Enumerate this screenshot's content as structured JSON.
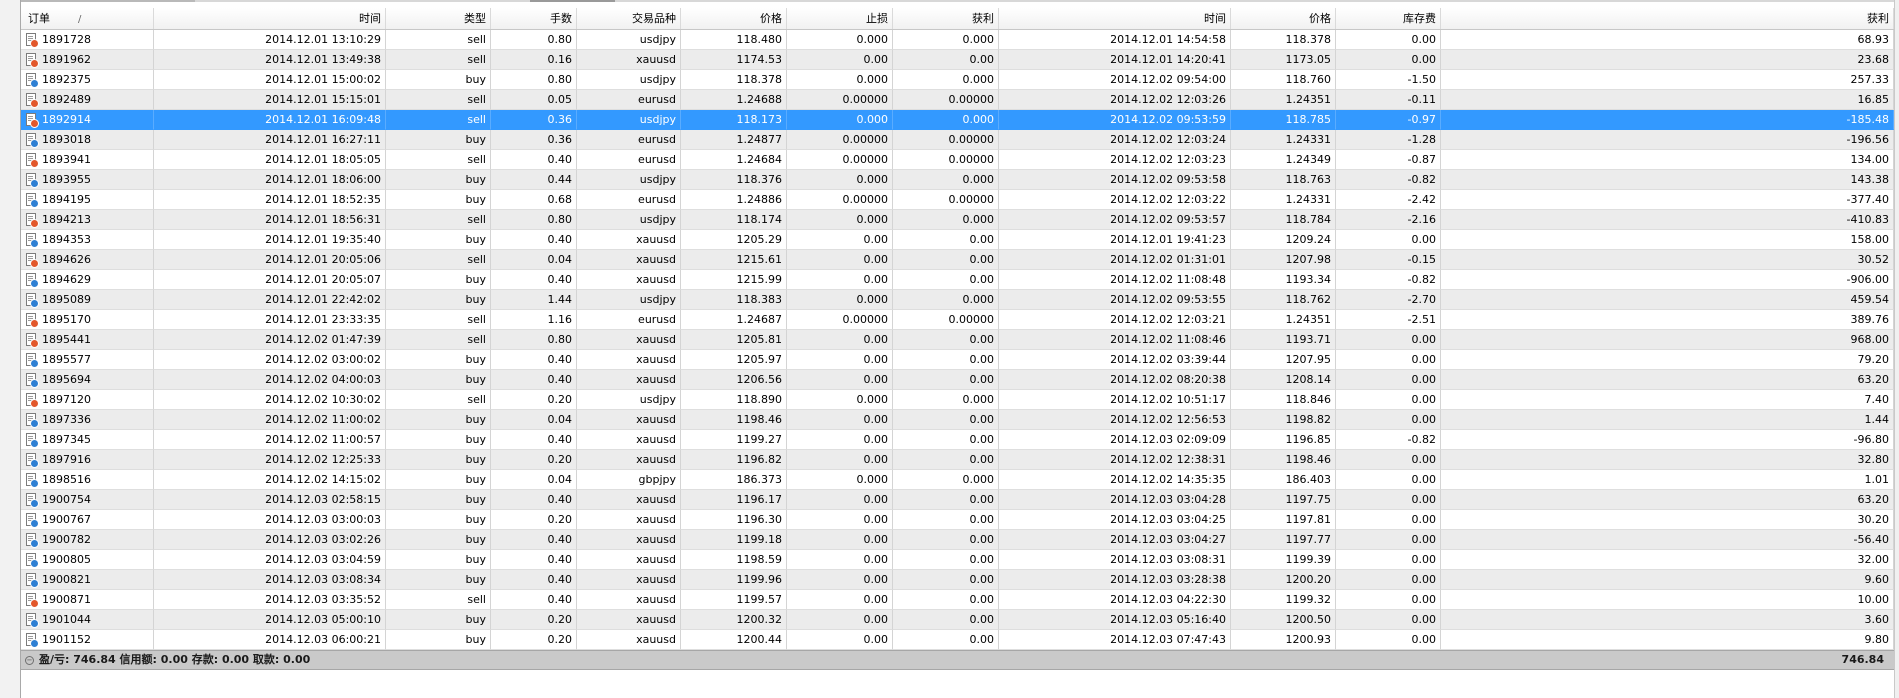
{
  "colors": {
    "selection": "#3399ff",
    "sell_badge": "#e2572b",
    "buy_badge": "#2e7fd3",
    "summary_bg": "#c9c9c9"
  },
  "sort_indicator": "/",
  "columns": [
    "订单",
    "时间",
    "类型",
    "手数",
    "交易品种",
    "价格",
    "止损",
    "获利",
    "时间",
    "价格",
    "库存费",
    "获利"
  ],
  "selected_order": "1892914",
  "rows": [
    [
      "1891728",
      "2014.12.01 13:10:29",
      "sell",
      "0.80",
      "usdjpy",
      "118.480",
      "0.000",
      "0.000",
      "2014.12.01 14:54:58",
      "118.378",
      "0.00",
      "68.93"
    ],
    [
      "1891962",
      "2014.12.01 13:49:38",
      "sell",
      "0.16",
      "xauusd",
      "1174.53",
      "0.00",
      "0.00",
      "2014.12.01 14:20:41",
      "1173.05",
      "0.00",
      "23.68"
    ],
    [
      "1892375",
      "2014.12.01 15:00:02",
      "buy",
      "0.80",
      "usdjpy",
      "118.378",
      "0.000",
      "0.000",
      "2014.12.02 09:54:00",
      "118.760",
      "-1.50",
      "257.33"
    ],
    [
      "1892489",
      "2014.12.01 15:15:01",
      "sell",
      "0.05",
      "eurusd",
      "1.24688",
      "0.00000",
      "0.00000",
      "2014.12.02 12:03:26",
      "1.24351",
      "-0.11",
      "16.85"
    ],
    [
      "1892914",
      "2014.12.01 16:09:48",
      "sell",
      "0.36",
      "usdjpy",
      "118.173",
      "0.000",
      "0.000",
      "2014.12.02 09:53:59",
      "118.785",
      "-0.97",
      "-185.48"
    ],
    [
      "1893018",
      "2014.12.01 16:27:11",
      "buy",
      "0.36",
      "eurusd",
      "1.24877",
      "0.00000",
      "0.00000",
      "2014.12.02 12:03:24",
      "1.24331",
      "-1.28",
      "-196.56"
    ],
    [
      "1893941",
      "2014.12.01 18:05:05",
      "sell",
      "0.40",
      "eurusd",
      "1.24684",
      "0.00000",
      "0.00000",
      "2014.12.02 12:03:23",
      "1.24349",
      "-0.87",
      "134.00"
    ],
    [
      "1893955",
      "2014.12.01 18:06:00",
      "buy",
      "0.44",
      "usdjpy",
      "118.376",
      "0.000",
      "0.000",
      "2014.12.02 09:53:58",
      "118.763",
      "-0.82",
      "143.38"
    ],
    [
      "1894195",
      "2014.12.01 18:52:35",
      "buy",
      "0.68",
      "eurusd",
      "1.24886",
      "0.00000",
      "0.00000",
      "2014.12.02 12:03:22",
      "1.24331",
      "-2.42",
      "-377.40"
    ],
    [
      "1894213",
      "2014.12.01 18:56:31",
      "sell",
      "0.80",
      "usdjpy",
      "118.174",
      "0.000",
      "0.000",
      "2014.12.02 09:53:57",
      "118.784",
      "-2.16",
      "-410.83"
    ],
    [
      "1894353",
      "2014.12.01 19:35:40",
      "buy",
      "0.40",
      "xauusd",
      "1205.29",
      "0.00",
      "0.00",
      "2014.12.01 19:41:23",
      "1209.24",
      "0.00",
      "158.00"
    ],
    [
      "1894626",
      "2014.12.01 20:05:06",
      "sell",
      "0.04",
      "xauusd",
      "1215.61",
      "0.00",
      "0.00",
      "2014.12.02 01:31:01",
      "1207.98",
      "-0.15",
      "30.52"
    ],
    [
      "1894629",
      "2014.12.01 20:05:07",
      "buy",
      "0.40",
      "xauusd",
      "1215.99",
      "0.00",
      "0.00",
      "2014.12.02 11:08:48",
      "1193.34",
      "-0.82",
      "-906.00"
    ],
    [
      "1895089",
      "2014.12.01 22:42:02",
      "buy",
      "1.44",
      "usdjpy",
      "118.383",
      "0.000",
      "0.000",
      "2014.12.02 09:53:55",
      "118.762",
      "-2.70",
      "459.54"
    ],
    [
      "1895170",
      "2014.12.01 23:33:35",
      "sell",
      "1.16",
      "eurusd",
      "1.24687",
      "0.00000",
      "0.00000",
      "2014.12.02 12:03:21",
      "1.24351",
      "-2.51",
      "389.76"
    ],
    [
      "1895441",
      "2014.12.02 01:47:39",
      "sell",
      "0.80",
      "xauusd",
      "1205.81",
      "0.00",
      "0.00",
      "2014.12.02 11:08:46",
      "1193.71",
      "0.00",
      "968.00"
    ],
    [
      "1895577",
      "2014.12.02 03:00:02",
      "buy",
      "0.40",
      "xauusd",
      "1205.97",
      "0.00",
      "0.00",
      "2014.12.02 03:39:44",
      "1207.95",
      "0.00",
      "79.20"
    ],
    [
      "1895694",
      "2014.12.02 04:00:03",
      "buy",
      "0.40",
      "xauusd",
      "1206.56",
      "0.00",
      "0.00",
      "2014.12.02 08:20:38",
      "1208.14",
      "0.00",
      "63.20"
    ],
    [
      "1897120",
      "2014.12.02 10:30:02",
      "sell",
      "0.20",
      "usdjpy",
      "118.890",
      "0.000",
      "0.000",
      "2014.12.02 10:51:17",
      "118.846",
      "0.00",
      "7.40"
    ],
    [
      "1897336",
      "2014.12.02 11:00:02",
      "buy",
      "0.04",
      "xauusd",
      "1198.46",
      "0.00",
      "0.00",
      "2014.12.02 12:56:53",
      "1198.82",
      "0.00",
      "1.44"
    ],
    [
      "1897345",
      "2014.12.02 11:00:57",
      "buy",
      "0.40",
      "xauusd",
      "1199.27",
      "0.00",
      "0.00",
      "2014.12.03 02:09:09",
      "1196.85",
      "-0.82",
      "-96.80"
    ],
    [
      "1897916",
      "2014.12.02 12:25:33",
      "buy",
      "0.20",
      "xauusd",
      "1196.82",
      "0.00",
      "0.00",
      "2014.12.02 12:38:31",
      "1198.46",
      "0.00",
      "32.80"
    ],
    [
      "1898516",
      "2014.12.02 14:15:02",
      "buy",
      "0.04",
      "gbpjpy",
      "186.373",
      "0.000",
      "0.000",
      "2014.12.02 14:35:35",
      "186.403",
      "0.00",
      "1.01"
    ],
    [
      "1900754",
      "2014.12.03 02:58:15",
      "buy",
      "0.40",
      "xauusd",
      "1196.17",
      "0.00",
      "0.00",
      "2014.12.03 03:04:28",
      "1197.75",
      "0.00",
      "63.20"
    ],
    [
      "1900767",
      "2014.12.03 03:00:03",
      "buy",
      "0.20",
      "xauusd",
      "1196.30",
      "0.00",
      "0.00",
      "2014.12.03 03:04:25",
      "1197.81",
      "0.00",
      "30.20"
    ],
    [
      "1900782",
      "2014.12.03 03:02:26",
      "buy",
      "0.40",
      "xauusd",
      "1199.18",
      "0.00",
      "0.00",
      "2014.12.03 03:04:27",
      "1197.77",
      "0.00",
      "-56.40"
    ],
    [
      "1900805",
      "2014.12.03 03:04:59",
      "buy",
      "0.40",
      "xauusd",
      "1198.59",
      "0.00",
      "0.00",
      "2014.12.03 03:08:31",
      "1199.39",
      "0.00",
      "32.00"
    ],
    [
      "1900821",
      "2014.12.03 03:08:34",
      "buy",
      "0.40",
      "xauusd",
      "1199.96",
      "0.00",
      "0.00",
      "2014.12.03 03:28:38",
      "1200.20",
      "0.00",
      "9.60"
    ],
    [
      "1900871",
      "2014.12.03 03:35:52",
      "sell",
      "0.40",
      "xauusd",
      "1199.57",
      "0.00",
      "0.00",
      "2014.12.03 04:22:30",
      "1199.32",
      "0.00",
      "10.00"
    ],
    [
      "1901044",
      "2014.12.03 05:00:10",
      "buy",
      "0.20",
      "xauusd",
      "1200.32",
      "0.00",
      "0.00",
      "2014.12.03 05:16:40",
      "1200.50",
      "0.00",
      "3.60"
    ],
    [
      "1901152",
      "2014.12.03 06:00:21",
      "buy",
      "0.20",
      "xauusd",
      "1200.44",
      "0.00",
      "0.00",
      "2014.12.03 07:47:43",
      "1200.93",
      "0.00",
      "9.80"
    ]
  ],
  "summary": {
    "text": "盈/亏: 746.84  信用额: 0.00  存款: 0.00  取款: 0.00",
    "total": "746.84",
    "icon": "collapse-circle-icon"
  },
  "row_icon": "order-document-icon"
}
